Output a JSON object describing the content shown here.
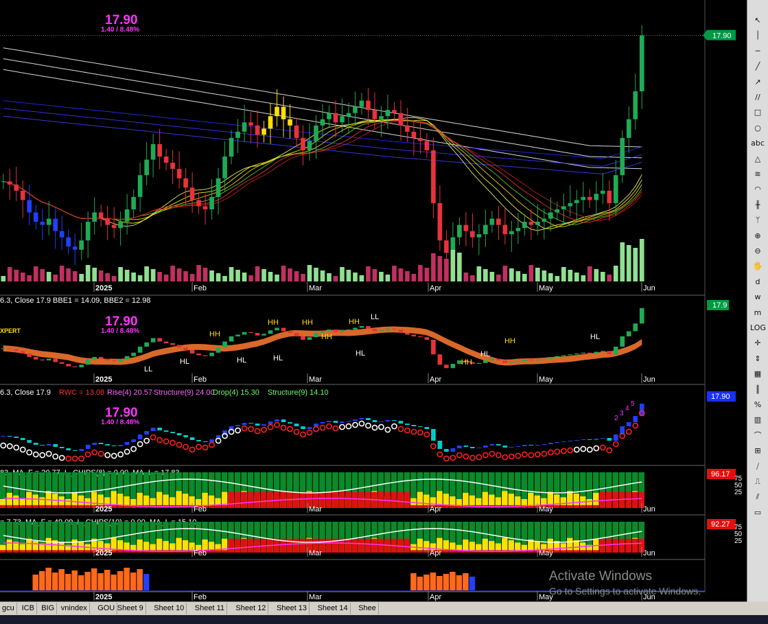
{
  "chart_data": {
    "type": "candlestick",
    "title_fragment": "Close 17.9",
    "last_close": 17.9,
    "change_label": "1.40 / 8.48%",
    "price_big": "17.90",
    "price_tag": "17.90",
    "time_labels": [
      "2025",
      "Feb",
      "Mar",
      "Apr",
      "May",
      "Jun"
    ],
    "close_series": [
      13.2,
      13.1,
      12.9,
      12.6,
      12.2,
      11.9,
      11.8,
      12.0,
      11.6,
      11.4,
      11.1,
      11.0,
      11.3,
      11.9,
      12.2,
      12.0,
      11.8,
      11.7,
      11.9,
      12.3,
      12.7,
      13.4,
      13.9,
      14.4,
      14.0,
      13.8,
      13.6,
      13.3,
      13.0,
      12.6,
      12.4,
      12.3,
      12.7,
      13.3,
      14.0,
      14.6,
      14.8,
      15.1,
      15.0,
      14.7,
      14.9,
      15.3,
      15.6,
      15.2,
      15.0,
      14.6,
      14.2,
      14.5,
      15.0,
      15.2,
      15.4,
      15.1,
      15.3,
      15.4,
      15.6,
      15.8,
      15.5,
      15.2,
      15.3,
      15.5,
      15.4,
      15.0,
      14.8,
      14.6,
      14.5,
      14.2,
      12.5,
      11.3,
      10.9,
      11.4,
      11.8,
      11.6,
      11.4,
      11.5,
      11.8,
      12.0,
      11.8,
      11.5,
      11.6,
      11.7,
      11.9,
      11.8,
      11.9,
      12.0,
      12.2,
      12.3,
      12.4,
      12.5,
      12.6,
      12.7,
      12.6,
      12.8,
      12.9,
      12.5,
      13.4,
      14.6,
      15.2,
      16.1,
      17.9
    ],
    "panel2": {
      "header": "6.3, Close 17.9 BBE1 = 14.09, BBE2 = 12.98",
      "price_big": "17.90",
      "change_label": "1.40 / 8.48%",
      "price_tag": "17.9",
      "expert_label": "XPERT",
      "swing_labels": [
        "LL",
        "HL",
        "HH",
        "HL",
        "HH",
        "HH",
        "HL",
        "HH",
        "HH",
        "HL",
        "LL",
        "HH",
        "HL",
        "HH",
        "HL"
      ]
    },
    "panel3": {
      "header_prefix": "6.3, Close 17.9 ",
      "rwc": "RWC = 13.08",
      "rise": "Rise(4) 20.57",
      "structure1": "Structure(9) 24.00",
      "drop": "Drop(4) 15.30",
      "structure2": "Structure(9) 14.10",
      "price_big": "17.90",
      "change_label": "1.40 / 8.48%",
      "price_tag": "17.90",
      "count_labels": [
        "2",
        "3",
        "4",
        "5"
      ]
    },
    "panel4": {
      "header": "83, MA_F = 20.77, L_CHIPS(8) = 0.00, MA_L = 17.83",
      "value_tag": "96.17",
      "ticks": [
        "75",
        "50",
        "25"
      ]
    },
    "panel5": {
      "header": "= 7.73, MA_F = 49.09, L_CHIPS(10) = 0.00, MA_L = 15.10",
      "value_tag": "92.27",
      "ticks": [
        "75",
        "50",
        "25"
      ]
    },
    "watermark": {
      "line1": "Activate Windows",
      "line2": "Go to Settings to activate Windows."
    }
  },
  "colors": {
    "up": "#1faa55",
    "down": "#e8323c",
    "blue": "#2040ff",
    "yellow": "#ffe000",
    "magenta": "#ff33ff",
    "vol_up": "#8fe08f",
    "vol_down": "#c03060",
    "tag_bg": "#009944"
  },
  "tabs": [
    "gcu",
    "ICB",
    "BIG",
    "vnindex",
    "GOU",
    "Sheet 9",
    "Sheet 10",
    "Sheet 11",
    "Sheet 12",
    "Sheet 13",
    "Sheet 14",
    "Shee"
  ],
  "toolbar_icons": [
    "cursor-icon",
    "vertical-line-icon",
    "horizontal-line-icon",
    "trend-line-icon",
    "ray-icon",
    "channel-icon",
    "rectangle-icon",
    "ellipse-icon",
    "text-icon",
    "triangle-icon",
    "fibonacci-icon",
    "arc-icon",
    "gann-icon",
    "pitchfork-icon",
    "zoom-in-icon",
    "zoom-out-icon",
    "hand-icon",
    "d-icon",
    "w-icon",
    "m-icon",
    "log-icon",
    "cross-icon",
    "arrow-up-down-icon",
    "grid-icon",
    "bars-icon",
    "percent-icon",
    "chart-icon",
    "wave-icon",
    "table-icon",
    "slash-icon",
    "cycle-icon",
    "gann-fan-icon",
    "bottom-icon"
  ],
  "toolbar_glyphs": [
    "↖",
    "│",
    "─",
    "╱",
    "↗",
    "//",
    "□",
    "○",
    "abc",
    "△",
    "≋",
    "◠",
    "╫",
    "ᛘ",
    "⊕",
    "⊖",
    "🖐",
    "d",
    "w",
    "m",
    "LOG",
    "✛",
    "⇕",
    "▦",
    "║",
    "%",
    "▥",
    "⌒",
    "⊞",
    "⧸",
    "⎍",
    "⫽",
    "▭"
  ]
}
